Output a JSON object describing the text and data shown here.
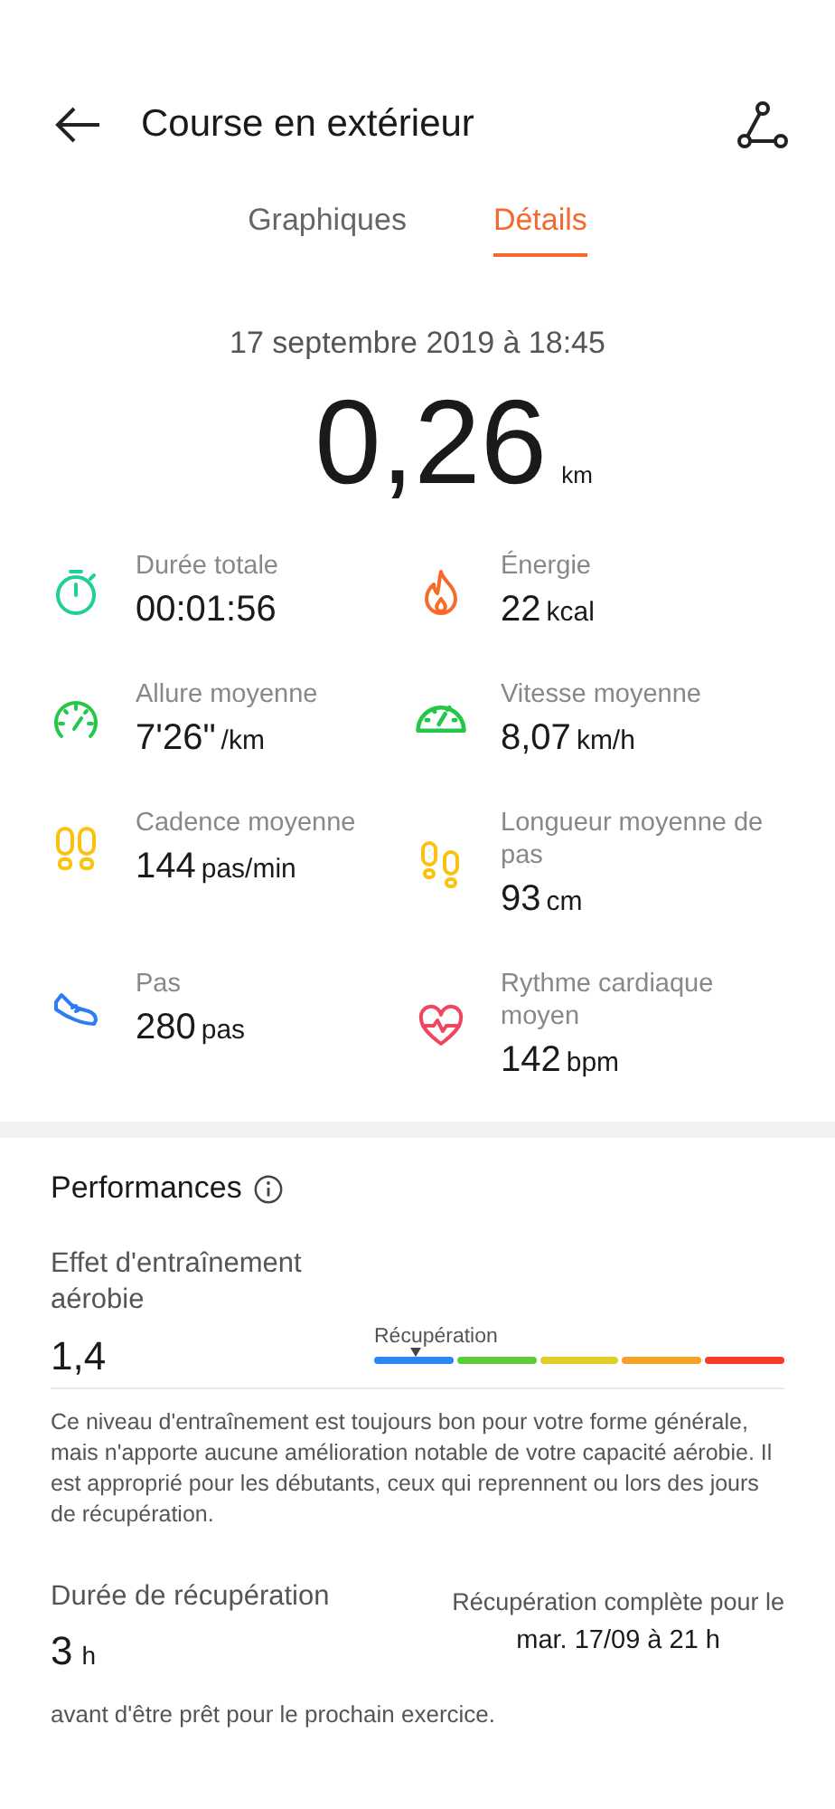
{
  "header": {
    "title": "Course en extérieur"
  },
  "tabs": [
    {
      "label": "Graphiques",
      "selected": false
    },
    {
      "label": "Détails",
      "selected": true
    }
  ],
  "date": "17 septembre 2019 à 18:45",
  "distance": {
    "value": "0,26",
    "unit": "km"
  },
  "stats": [
    {
      "kind": "stopwatch",
      "label": "Durée totale",
      "value": "00:01:56"
    },
    {
      "kind": "flame",
      "label": "Énergie",
      "value": "22",
      "unit": "kcal"
    },
    {
      "kind": "pace",
      "label": "Allure moyenne",
      "value": "7'26\"",
      "unit": "/km"
    },
    {
      "kind": "speed",
      "label": "Vitesse moyenne",
      "value": "8,07",
      "unit": "km/h"
    },
    {
      "kind": "footprints",
      "label": "Cadence moyenne",
      "value": "144",
      "unit": "pas/min"
    },
    {
      "kind": "stride",
      "label": "Longueur moyenne de pas",
      "value": "93",
      "unit": "cm"
    },
    {
      "kind": "shoe",
      "label": "Pas",
      "value": "280",
      "unit": "pas"
    },
    {
      "kind": "heart",
      "label": "Rythme cardiaque moyen",
      "value": "142",
      "unit": "bpm"
    }
  ],
  "performance": {
    "title": "Performances",
    "aerobic": {
      "label": "Effet d'entraînement aérobie",
      "value": "1,4",
      "scale_label": "Récupération",
      "segments": [
        {
          "color": "#2a86f0"
        },
        {
          "color": "#5ccd3a"
        },
        {
          "color": "#e0cf2a"
        },
        {
          "color": "#f5a22a"
        },
        {
          "color": "#f53a2a"
        }
      ]
    },
    "description": "Ce niveau d'entraînement est toujours bon pour votre forme générale, mais n'apporte aucune amélioration notable de votre capacité aérobie. Il est approprié pour les débutants, ceux qui reprennent ou lors des jours de récupération.",
    "recovery": {
      "label": "Durée de récupération",
      "value": "3",
      "unit": "h",
      "complete_label": "Récupération complète pour le",
      "complete_time": "mar. 17/09 à 21 h",
      "note": "avant d'être prêt pour le prochain exercice."
    }
  }
}
